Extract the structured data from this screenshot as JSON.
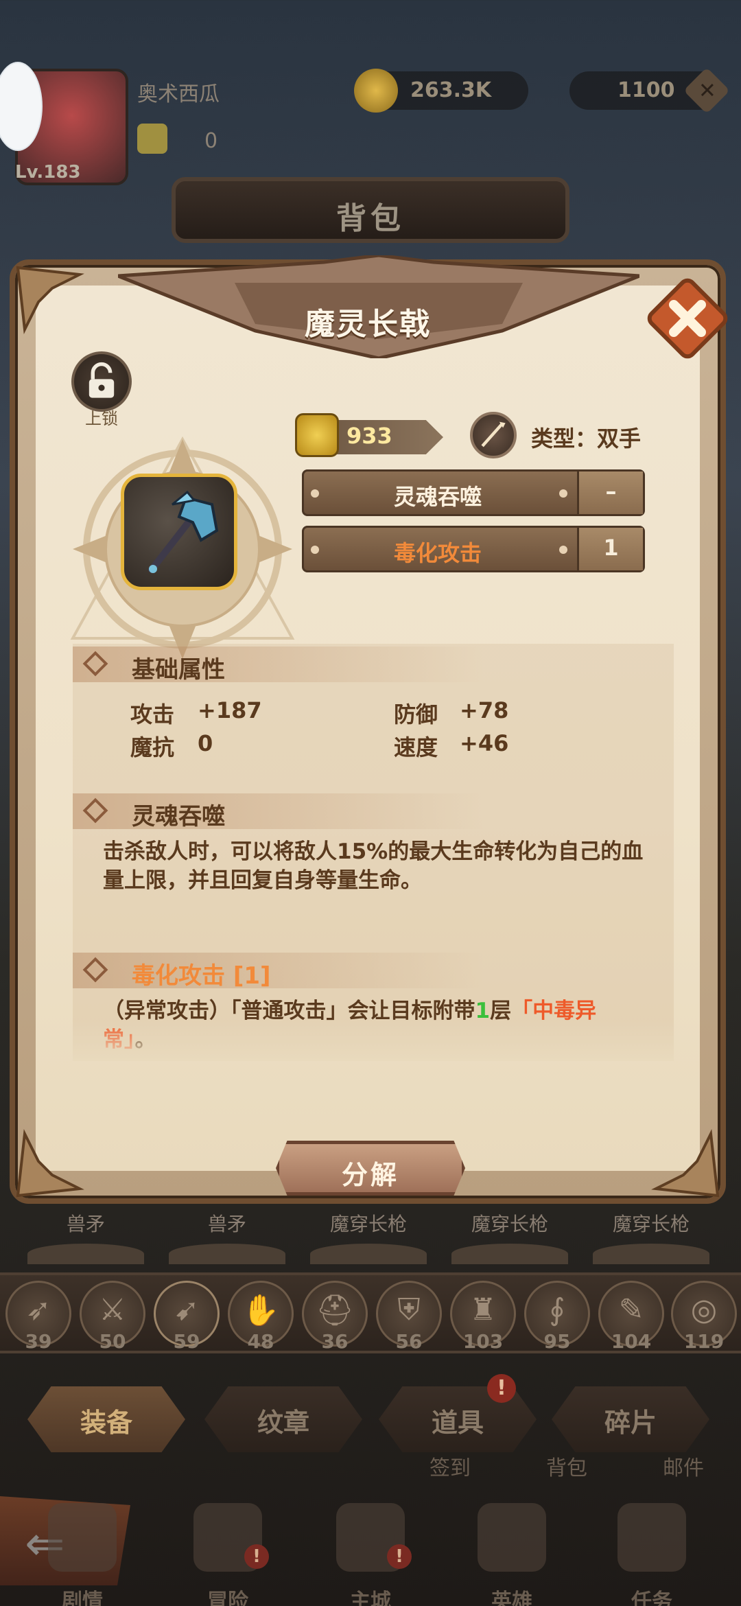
{
  "player": {
    "name": "奥术西瓜",
    "level": "Lv.183",
    "stamina": "0"
  },
  "currency": {
    "gold": "263.3K",
    "gems": "1100"
  },
  "window": {
    "title": "背包"
  },
  "item": {
    "name": "魔灵长戟",
    "lock_label": "上锁",
    "power": "933",
    "type_label": "类型：双手",
    "skills": [
      {
        "name": "灵魂吞噬",
        "level": "–",
        "color": "#fdf1de"
      },
      {
        "name": "毒化攻击",
        "level": "1",
        "color": "#f28a3a"
      }
    ],
    "base_stats": {
      "title": "基础属性",
      "attack_label": "攻击",
      "attack_val": "+187",
      "defense_label": "防御",
      "defense_val": "+78",
      "magic_res_label": "魔抗",
      "magic_res_val": "0",
      "speed_label": "速度",
      "speed_val": "+46"
    },
    "soul_section": {
      "title": "灵魂吞噬",
      "text": "击杀敌人时，可以将敌人15%的最大生命转化为自己的血量上限，并且回复自身等量生命。"
    },
    "poison_section": {
      "title": "毒化攻击 [1]",
      "text_part1": "（异常攻击）「普通攻击」会让目标附带",
      "text_num": "1",
      "text_part2": "层",
      "text_highlight": "「中毒异常」",
      "text_part3": "。"
    },
    "decompose_label": "分解"
  },
  "gear_names": [
    "兽矛",
    "兽矛",
    "魔穿长枪",
    "魔穿长枪",
    "魔穿长枪"
  ],
  "categories": [
    {
      "icon": "bow-icon",
      "glyph": "➶",
      "count": "39"
    },
    {
      "icon": "sword-icon",
      "glyph": "⚔",
      "count": "50"
    },
    {
      "icon": "spear-icon",
      "glyph": "➹",
      "count": "59"
    },
    {
      "icon": "claw-icon",
      "glyph": "✋",
      "count": "48"
    },
    {
      "icon": "helmet-icon",
      "glyph": "⛑",
      "count": "36"
    },
    {
      "icon": "shield-icon",
      "glyph": "⛨",
      "count": "56"
    },
    {
      "icon": "armor-icon",
      "glyph": "♜",
      "count": "103"
    },
    {
      "icon": "staff-icon",
      "glyph": "∮",
      "count": "95"
    },
    {
      "icon": "book-icon",
      "glyph": "✎",
      "count": "104"
    },
    {
      "icon": "orb-icon",
      "glyph": "◎",
      "count": "119"
    }
  ],
  "tabs": [
    "装备",
    "纹章",
    "道具",
    "碎片"
  ],
  "tab_alert": "!",
  "sub_labels": [
    "签到",
    "背包",
    "邮件"
  ],
  "bottom_nav": [
    {
      "label": "剧情",
      "alert": ""
    },
    {
      "label": "冒险",
      "alert": "!"
    },
    {
      "label": "主城",
      "alert": "!"
    },
    {
      "label": "英雄",
      "alert": ""
    },
    {
      "label": "任务",
      "alert": ""
    }
  ],
  "colors": {
    "gold_frame": "#e4b43c",
    "accent_orange": "#f28a3a",
    "highlight_red": "#ee5a2a",
    "green_num": "#3bbf3b"
  }
}
